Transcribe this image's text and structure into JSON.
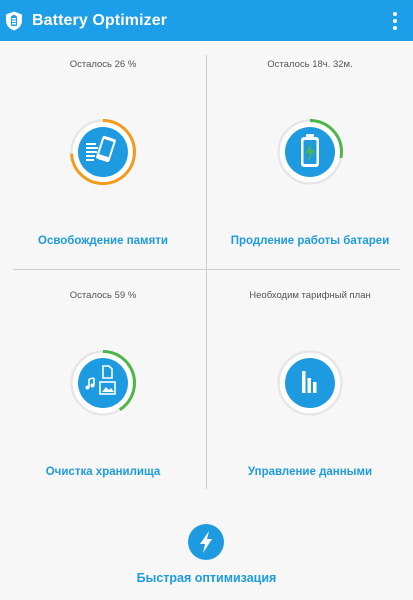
{
  "app": {
    "title": "Battery Optimizer",
    "logo_icon": "shield-battery-icon",
    "menu_icon": "more-vert-icon"
  },
  "colors": {
    "appbar": "#1c9ee8",
    "accent": "#1e9be0",
    "progress_orange": "#f49a1c",
    "progress_green": "#4cb748",
    "ring_track": "#e6e6e6"
  },
  "tiles": [
    {
      "status": "Осталось 26 %",
      "label": "Освобождение памяти",
      "icon": "phone-boost-icon",
      "progress": 0.74,
      "progress_color": "#f49a1c"
    },
    {
      "status": "Осталось 18ч. 32м.",
      "label": "Продление работы батареи",
      "icon": "battery-charge-icon",
      "progress": 0.28,
      "progress_color": "#4cb748"
    },
    {
      "status": "Осталось 59 %",
      "label": "Очистка хранилища",
      "icon": "media-files-icon",
      "progress": 0.41,
      "progress_color": "#4cb748"
    },
    {
      "status": "Необходим тарифный план",
      "label": "Управление данными",
      "icon": "bar-chart-icon",
      "progress": 0,
      "progress_color": "#4cb748"
    }
  ],
  "quick_optimize": {
    "label": "Быстрая оптимизация",
    "icon": "lightning-icon"
  }
}
